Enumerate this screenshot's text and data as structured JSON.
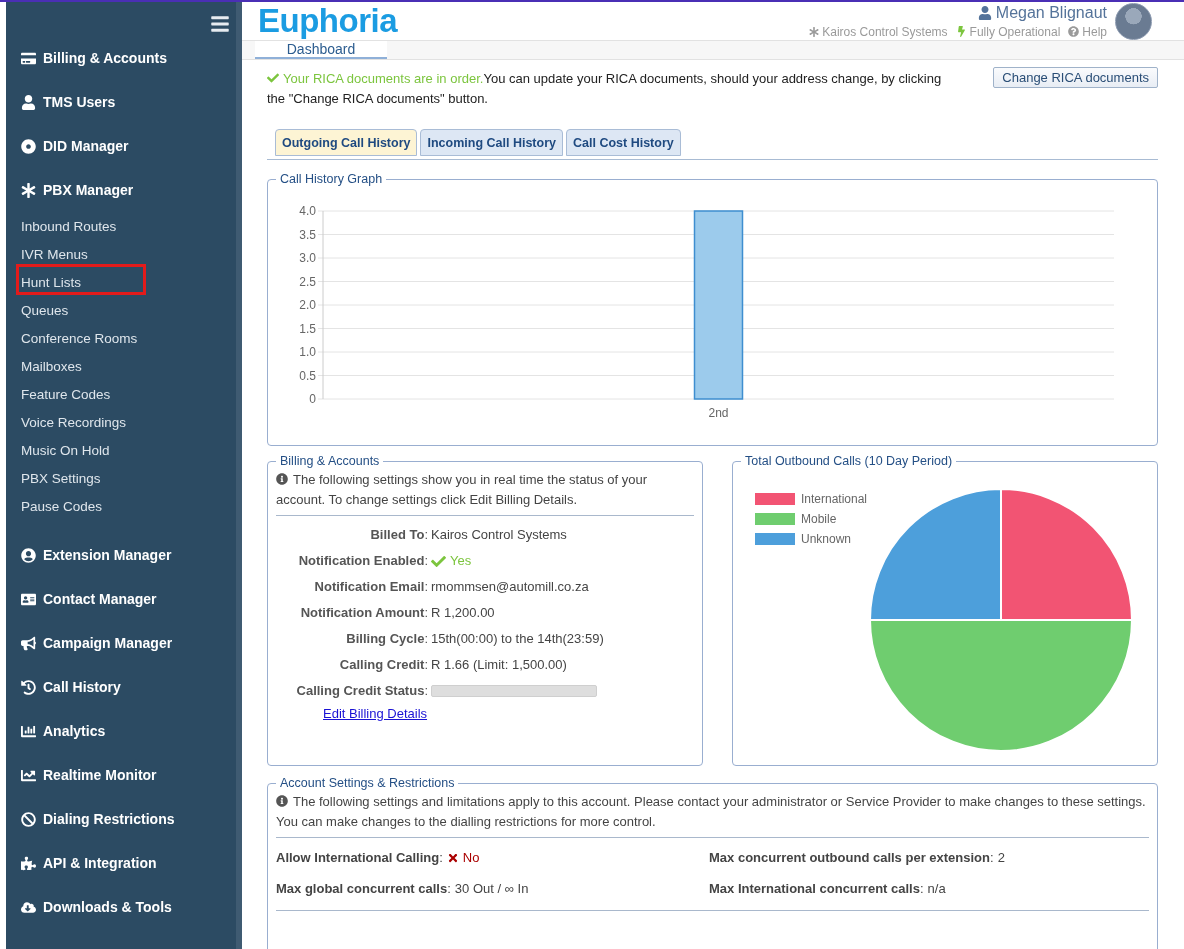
{
  "sidebar": {
    "items": [
      {
        "label": "Billing & Accounts",
        "kind": "section",
        "highlighted": false
      },
      {
        "label": "TMS Users",
        "kind": "section",
        "highlighted": false
      },
      {
        "label": "DID Manager",
        "kind": "section",
        "highlighted": false
      },
      {
        "label": "PBX Manager",
        "kind": "section",
        "highlighted": false
      },
      {
        "label": "Inbound Routes",
        "kind": "sub",
        "highlighted": false
      },
      {
        "label": "IVR Menus",
        "kind": "sub",
        "highlighted": false
      },
      {
        "label": "Hunt Lists",
        "kind": "sub",
        "highlighted": true
      },
      {
        "label": "Queues",
        "kind": "sub",
        "highlighted": false
      },
      {
        "label": "Conference Rooms",
        "kind": "sub",
        "highlighted": false
      },
      {
        "label": "Mailboxes",
        "kind": "sub",
        "highlighted": false
      },
      {
        "label": "Feature Codes",
        "kind": "sub",
        "highlighted": false
      },
      {
        "label": "Voice Recordings",
        "kind": "sub",
        "highlighted": false
      },
      {
        "label": "Music On Hold",
        "kind": "sub",
        "highlighted": false
      },
      {
        "label": "PBX Settings",
        "kind": "sub",
        "highlighted": false
      },
      {
        "label": "Pause Codes",
        "kind": "sub",
        "highlighted": false
      },
      {
        "label": "Extension Manager",
        "kind": "section",
        "highlighted": false
      },
      {
        "label": "Contact Manager",
        "kind": "section",
        "highlighted": false
      },
      {
        "label": "Campaign Manager",
        "kind": "section",
        "highlighted": false
      },
      {
        "label": "Call History",
        "kind": "section",
        "highlighted": false
      },
      {
        "label": "Analytics",
        "kind": "section",
        "highlighted": false
      },
      {
        "label": "Realtime Monitor",
        "kind": "section",
        "highlighted": false
      },
      {
        "label": "Dialing Restrictions",
        "kind": "section",
        "highlighted": false
      },
      {
        "label": "API & Integration",
        "kind": "section",
        "highlighted": false
      },
      {
        "label": "Downloads & Tools",
        "kind": "section",
        "highlighted": false
      }
    ]
  },
  "header": {
    "logo": "Euphoria",
    "user": "Megan Blignaut",
    "company": "Kairos Control Systems",
    "status": "Fully Operational",
    "help": "Help"
  },
  "page_tabs": [
    {
      "label": "Dashboard",
      "selected": true
    }
  ],
  "notice": {
    "status": "Your RICA documents are in order.",
    "text": "You can update your RICA documents, should your address change, by clicking the \"Change RICA documents\" button.",
    "button": "Change RICA documents"
  },
  "history_tabs": [
    {
      "label": "Outgoing Call History",
      "selected": true
    },
    {
      "label": "Incoming Call History",
      "selected": false
    },
    {
      "label": "Call Cost History",
      "selected": false
    }
  ],
  "call_history": {
    "title": "Call History Graph",
    "chart_data": {
      "type": "bar",
      "grid": true,
      "categories": [
        "2nd"
      ],
      "values": [
        4
      ],
      "ylim": [
        0,
        4
      ],
      "yticks": [
        {
          "value": 0,
          "label": "0"
        },
        {
          "value": 0.5,
          "label": "0.5"
        },
        {
          "value": 1,
          "label": "1.0"
        },
        {
          "value": 1.5,
          "label": "1.5"
        },
        {
          "value": 2,
          "label": "2.0"
        },
        {
          "value": 2.5,
          "label": "2.5"
        },
        {
          "value": 3,
          "label": "3.0"
        },
        {
          "value": 3.5,
          "label": "3.5"
        },
        {
          "value": 4,
          "label": "4.0"
        }
      ]
    }
  },
  "billing": {
    "title": "Billing & Accounts",
    "info": "The following settings show you in real time the status of your account. To change settings click Edit Billing Details.",
    "rows": [
      {
        "label": "**Billed To**:",
        "value": "Kairos Control Systems",
        "kind": "text"
      },
      {
        "label": "**Notification Enabled**:",
        "value": "Yes",
        "kind": "check"
      },
      {
        "label": "**Notification Email**:",
        "value": "rmommsen@automill.co.za",
        "kind": "text"
      },
      {
        "label": "**Notification Amount**:",
        "value": "R 1,200.00",
        "kind": "text"
      },
      {
        "label": "**Billing Cycle**:",
        "value": "15th(00:00) to the 14th(23:59)",
        "kind": "text"
      },
      {
        "label": "**Calling Credit**:",
        "value": "R 1.66 (Limit: 1,500.00)",
        "kind": "text"
      },
      {
        "label": "**Calling Credit Status**:",
        "kind": "meter"
      }
    ],
    "link": "Edit Billing Details"
  },
  "outbound": {
    "title": "Total Outbound Calls (10 Day Period)",
    "chart_data": {
      "type": "pie",
      "categories": [
        "International",
        "Mobile",
        "Unknown"
      ],
      "values": [
        25,
        50,
        25
      ],
      "colors": [
        "#f25473",
        "#6fcd6f",
        "#4d9fdb"
      ]
    }
  },
  "account": {
    "title": "Account Settings & Restrictions",
    "info": "The following settings and limitations apply to this account. Please contact your administrator or Service Provider to make changes to these settings. You can make changes to the dialling restrictions for more control.",
    "rows": [
      {
        "label": "**Allow International Calling**:",
        "value": "No",
        "kind": "cross"
      },
      {
        "label": "**Max concurrent outbound calls per extension**:",
        "value": "2",
        "kind": "text"
      },
      {
        "label": "**Max global concurrent calls**:",
        "value": "30 Out / ∞ In",
        "kind": "text"
      },
      {
        "label": "**Max International concurrent calls**:",
        "value": "n/a",
        "kind": "text"
      }
    ]
  }
}
